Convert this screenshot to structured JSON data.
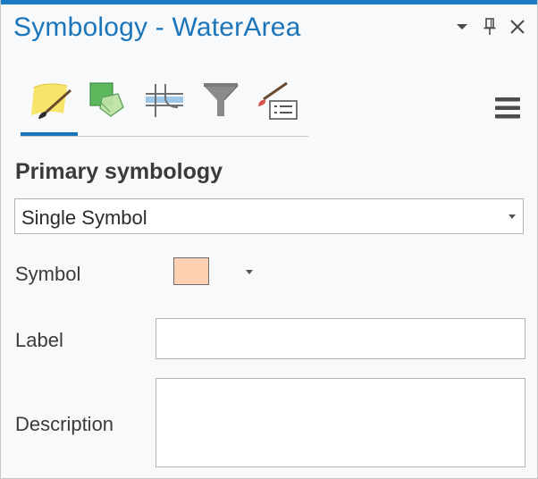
{
  "pane": {
    "title": "Symbology - WaterArea",
    "controls": [
      {
        "name": "options-dropdown-icon"
      },
      {
        "name": "pin-icon"
      },
      {
        "name": "close-icon"
      }
    ]
  },
  "tabs": [
    {
      "icon": "primary-symbology-icon",
      "selected": true
    },
    {
      "icon": "vary-symbology-icon",
      "selected": false
    },
    {
      "icon": "symbol-layer-drawing-icon",
      "selected": false
    },
    {
      "icon": "symbol-classes-filter-icon",
      "selected": false
    },
    {
      "icon": "symbology-settings-icon",
      "selected": false
    }
  ],
  "menu_icon": "hamburger-menu-icon",
  "primary_symbology": {
    "heading": "Primary symbology",
    "selected_value": "Single Symbol"
  },
  "fields": {
    "symbol_label": "Symbol",
    "symbol_color": "#fdd0b1",
    "label_label": "Label",
    "label_value": "",
    "description_label": "Description",
    "description_value": ""
  },
  "colors": {
    "accent": "#1b75bb",
    "title_text": "#1b75bb"
  }
}
